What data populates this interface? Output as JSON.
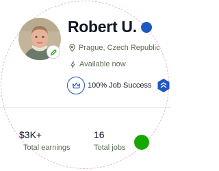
{
  "profile": {
    "name": "Robert U.",
    "location": "Prague, Czech Republic",
    "availability": "Available now",
    "job_success": "100% Job Success"
  },
  "stats": {
    "earnings_value": "$3K+",
    "earnings_label": "Total earnings",
    "jobs_value": "16",
    "jobs_label": "Total jobs"
  },
  "colors": {
    "brand_blue": "#1f57c3",
    "online_green": "#14a800",
    "text_dark": "#0e1724",
    "text_muted": "#5e6d55"
  },
  "icons": {
    "edit": "pencil-icon",
    "verified": "verified-icon",
    "location": "location-pin-icon",
    "availability": "lightning-icon",
    "job_success": "crown-icon",
    "top_rated": "top-rated-badge-icon"
  }
}
